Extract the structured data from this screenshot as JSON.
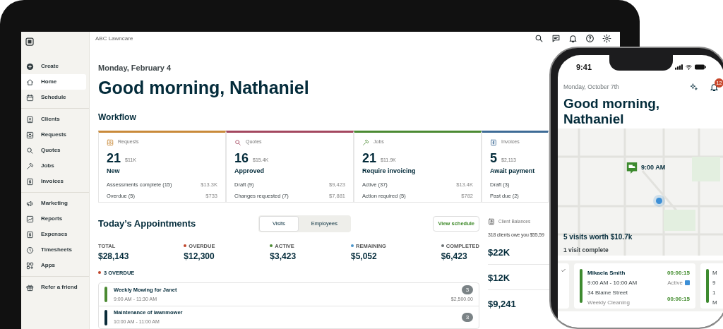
{
  "laptop": {
    "company": "ABC Lawncare",
    "sidebar": {
      "groups": [
        {
          "items": [
            {
              "label": "Create",
              "selected": false
            },
            {
              "label": "Home",
              "selected": true
            },
            {
              "label": "Schedule",
              "selected": false
            }
          ]
        },
        {
          "items": [
            {
              "label": "Clients",
              "selected": false
            },
            {
              "label": "Requests",
              "selected": false
            },
            {
              "label": "Quotes",
              "selected": false
            },
            {
              "label": "Jobs",
              "selected": false
            },
            {
              "label": "Invoices",
              "selected": false
            }
          ]
        },
        {
          "items": [
            {
              "label": "Marketing",
              "selected": false
            },
            {
              "label": "Reports",
              "selected": false
            },
            {
              "label": "Expenses",
              "selected": false
            },
            {
              "label": "Timesheets",
              "selected": false
            },
            {
              "label": "Apps",
              "selected": false
            }
          ]
        },
        {
          "items": [
            {
              "label": "Refer a friend",
              "selected": false
            }
          ]
        }
      ]
    },
    "date": "Monday, February 4",
    "greeting": "Good morning, Nathaniel",
    "workflow_title": "Workflow",
    "workflow": [
      {
        "label": "Requests",
        "color": "#c98a3a",
        "count": "21",
        "amount": "$11K",
        "status": "New",
        "lines": [
          {
            "label": "Assessments complete (15)",
            "value": "$13.3K"
          },
          {
            "label": "Overdue (5)",
            "value": "$733"
          }
        ]
      },
      {
        "label": "Quotes",
        "color": "#a3475f",
        "count": "16",
        "amount": "$15.4K",
        "status": "Approved",
        "lines": [
          {
            "label": "Draft (9)",
            "value": "$9,423"
          },
          {
            "label": "Changes requested (7)",
            "value": "$7,881"
          }
        ]
      },
      {
        "label": "Jobs",
        "color": "#4b8a32",
        "count": "21",
        "amount": "$11.9K",
        "status": "Require invoicing",
        "lines": [
          {
            "label": "Active (37)",
            "value": "$13.4K"
          },
          {
            "label": "Action required (5)",
            "value": "$782"
          }
        ]
      },
      {
        "label": "Invoices",
        "color": "#3d6b96",
        "count": "5",
        "amount": "$2,113",
        "status": "Await payment",
        "lines": [
          {
            "label": "Draft (3)"
          },
          {
            "label": "Past due (2)"
          }
        ]
      }
    ],
    "appointments": {
      "title": "Today’s Appointments",
      "tabs": [
        {
          "label": "Visits",
          "selected": true
        },
        {
          "label": "Employees",
          "selected": false
        }
      ],
      "button": "View schedule",
      "stats": [
        {
          "label": "TOTAL",
          "value": "$28,143"
        },
        {
          "label": "OVERDUE",
          "value": "$12,300",
          "color": "#c0452b"
        },
        {
          "label": "ACTIVE",
          "value": "$3,423",
          "color": "#4b8a32"
        },
        {
          "label": "REMAINING",
          "value": "$5,052",
          "color": "#4a94c9"
        },
        {
          "label": "COMPLETED",
          "value": "$6,423",
          "color": "#6b7173"
        }
      ],
      "overdue_label": "3 OVERDUE",
      "rows": [
        {
          "title": "Weekly Mowing for Janet",
          "time": "9:00 AM - 11:30 AM",
          "count": "3",
          "amount": "$2,500.00",
          "color": "#4b8a32"
        },
        {
          "title": "Maintenance of lawnmower",
          "time": "10:00 AM - 11:00 AM",
          "count": "3",
          "color": "#0a2c3a"
        }
      ]
    },
    "client_balances": {
      "title": "Client Balances",
      "summary": "318 clients owe you $55,59",
      "values": [
        "$22K",
        "$12K",
        "$9,241"
      ]
    }
  },
  "phone": {
    "time": "9:41",
    "date": "Monday, October 7th",
    "notification_count": "12",
    "greeting": "Good morning, Nathaniel",
    "pin_time": "9:00 AM",
    "visits_summary": "5 visits worth $10.7k",
    "visits_complete": "1 visit complete",
    "visit": {
      "name": "Mikaela Smith",
      "time": "9:00 AM - 10:00 AM",
      "address": "34 Blaine Street",
      "service": "Weekly Cleaning",
      "timer": "00:00:15",
      "status": "Active",
      "total": "00:00:15"
    },
    "next_visit_letters": [
      "M",
      "9",
      "1",
      "M"
    ]
  }
}
